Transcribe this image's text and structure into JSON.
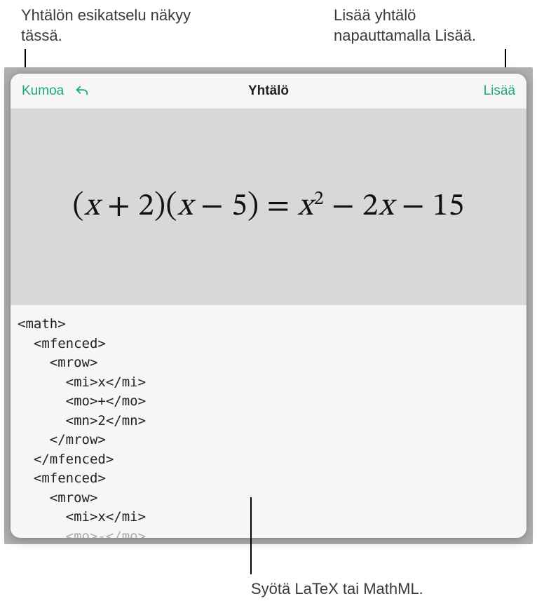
{
  "callouts": {
    "top_left": "Yhtälön esikatselu näkyy tässä.",
    "top_right": "Lisää yhtälö napauttamalla Lisää.",
    "bottom": "Syötä LaTeX tai MathML."
  },
  "toolbar": {
    "cancel_label": "Kumoa",
    "title": "Yhtälö",
    "insert_label": "Lisää"
  },
  "equation": {
    "display_text": "(x + 2)(x − 5) = x² − 2x − 15"
  },
  "source": {
    "lines": [
      "<math>",
      "  <mfenced>",
      "    <mrow>",
      "      <mi>x</mi>",
      "      <mo>+</mo>",
      "      <mn>2</mn>",
      "    </mrow>",
      "  </mfenced>",
      "  <mfenced>",
      "    <mrow>",
      "      <mi>x</mi>"
    ],
    "fade_line": "      <mo>-</mo>"
  }
}
